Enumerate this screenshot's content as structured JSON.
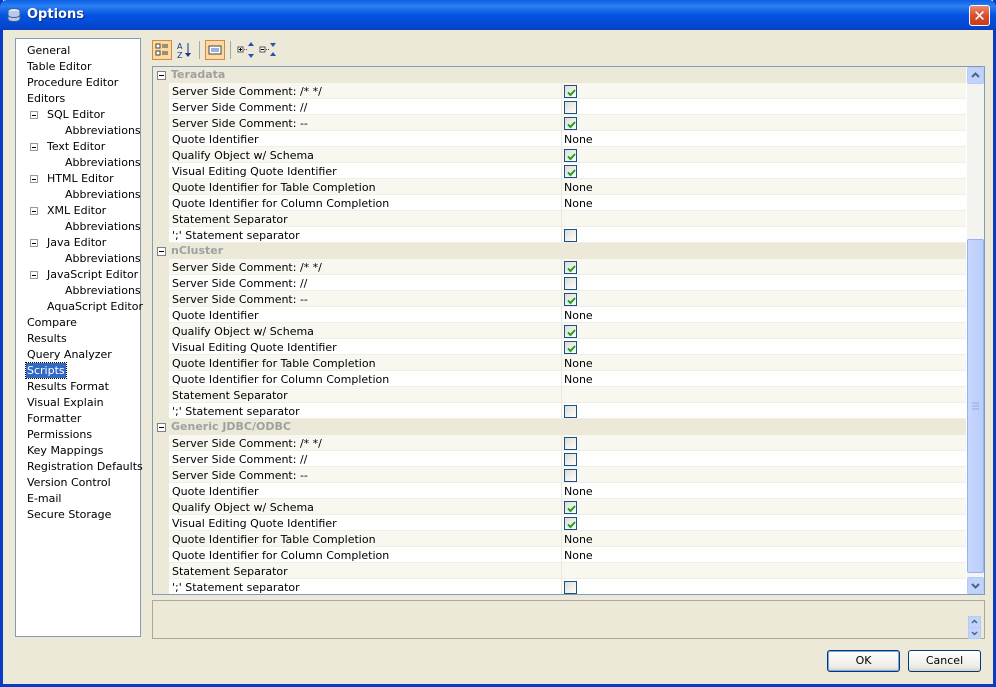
{
  "window": {
    "title": "Options"
  },
  "nav": {
    "selected": "Scripts",
    "items": [
      {
        "label": "General",
        "indent": 0
      },
      {
        "label": "Table Editor",
        "indent": 0
      },
      {
        "label": "Procedure Editor",
        "indent": 0
      },
      {
        "label": "Editors",
        "indent": 0
      },
      {
        "label": "SQL Editor",
        "indent": 1,
        "toggle": true
      },
      {
        "label": "Abbreviations",
        "indent": 2
      },
      {
        "label": "Text Editor",
        "indent": 1,
        "toggle": true
      },
      {
        "label": "Abbreviations",
        "indent": 2
      },
      {
        "label": "HTML Editor",
        "indent": 1,
        "toggle": true
      },
      {
        "label": "Abbreviations",
        "indent": 2
      },
      {
        "label": "XML Editor",
        "indent": 1,
        "toggle": true
      },
      {
        "label": "Abbreviations",
        "indent": 2
      },
      {
        "label": "Java Editor",
        "indent": 1,
        "toggle": true
      },
      {
        "label": "Abbreviations",
        "indent": 2
      },
      {
        "label": "JavaScript Editor",
        "indent": 1,
        "toggle": true
      },
      {
        "label": "Abbreviations",
        "indent": 2
      },
      {
        "label": "AquaScript Editor",
        "indent": 1
      },
      {
        "label": "Compare",
        "indent": 0
      },
      {
        "label": "Results",
        "indent": 0
      },
      {
        "label": "Query Analyzer",
        "indent": 0
      },
      {
        "label": "Scripts",
        "indent": 0
      },
      {
        "label": "Results Format",
        "indent": 0
      },
      {
        "label": "Visual Explain",
        "indent": 0
      },
      {
        "label": "Formatter",
        "indent": 0
      },
      {
        "label": "Permissions",
        "indent": 0
      },
      {
        "label": "Key Mappings",
        "indent": 0
      },
      {
        "label": "Registration Defaults",
        "indent": 0
      },
      {
        "label": "Version Control",
        "indent": 0
      },
      {
        "label": "E-mail",
        "indent": 0
      },
      {
        "label": "Secure Storage",
        "indent": 0
      }
    ]
  },
  "toolbar": {
    "buttons": [
      {
        "name": "categorized-view-icon",
        "active": true
      },
      {
        "name": "sort-alphabetical-icon",
        "active": false
      },
      {
        "name": "property-pages-icon",
        "active": true
      },
      {
        "name": "expand-all-icon",
        "active": false
      },
      {
        "name": "collapse-all-icon",
        "active": false
      }
    ]
  },
  "properties": {
    "categories": [
      {
        "name": "Teradata",
        "rows": [
          {
            "label": "Server Side Comment: /* */",
            "type": "checkbox",
            "checked": true
          },
          {
            "label": "Server Side Comment: //",
            "type": "checkbox",
            "checked": false
          },
          {
            "label": "Server Side Comment: --",
            "type": "checkbox",
            "checked": true
          },
          {
            "label": "Quote Identifier",
            "type": "text",
            "value": "None"
          },
          {
            "label": "Qualify Object w/ Schema",
            "type": "checkbox",
            "checked": true
          },
          {
            "label": "Visual Editing Quote Identifier",
            "type": "checkbox",
            "checked": true
          },
          {
            "label": "Quote Identifier for Table Completion",
            "type": "text",
            "value": "None"
          },
          {
            "label": "Quote Identifier for Column Completion",
            "type": "text",
            "value": "None"
          },
          {
            "label": "Statement Separator",
            "type": "text",
            "value": ""
          },
          {
            "label": "';' Statement separator",
            "type": "checkbox",
            "checked": false
          }
        ]
      },
      {
        "name": "nCluster",
        "rows": [
          {
            "label": "Server Side Comment: /* */",
            "type": "checkbox",
            "checked": true
          },
          {
            "label": "Server Side Comment: //",
            "type": "checkbox",
            "checked": false
          },
          {
            "label": "Server Side Comment: --",
            "type": "checkbox",
            "checked": true
          },
          {
            "label": "Quote Identifier",
            "type": "text",
            "value": "None"
          },
          {
            "label": "Qualify Object w/ Schema",
            "type": "checkbox",
            "checked": true
          },
          {
            "label": "Visual Editing Quote Identifier",
            "type": "checkbox",
            "checked": true
          },
          {
            "label": "Quote Identifier for Table Completion",
            "type": "text",
            "value": "None"
          },
          {
            "label": "Quote Identifier for Column Completion",
            "type": "text",
            "value": "None"
          },
          {
            "label": "Statement Separator",
            "type": "text",
            "value": ""
          },
          {
            "label": "';' Statement separator",
            "type": "checkbox",
            "checked": false
          }
        ]
      },
      {
        "name": "Generic JDBC/ODBC",
        "rows": [
          {
            "label": "Server Side Comment: /* */",
            "type": "checkbox",
            "checked": false
          },
          {
            "label": "Server Side Comment: //",
            "type": "checkbox",
            "checked": false
          },
          {
            "label": "Server Side Comment: --",
            "type": "checkbox",
            "checked": false
          },
          {
            "label": "Quote Identifier",
            "type": "text",
            "value": "None"
          },
          {
            "label": "Qualify Object w/ Schema",
            "type": "checkbox",
            "checked": true
          },
          {
            "label": "Visual Editing Quote Identifier",
            "type": "checkbox",
            "checked": true
          },
          {
            "label": "Quote Identifier for Table Completion",
            "type": "text",
            "value": "None"
          },
          {
            "label": "Quote Identifier for Column Completion",
            "type": "text",
            "value": "None"
          },
          {
            "label": "Statement Separator",
            "type": "text",
            "value": ""
          },
          {
            "label": "';' Statement separator",
            "type": "checkbox",
            "checked": false
          }
        ]
      }
    ]
  },
  "buttons": {
    "ok_label": "OK",
    "cancel_label": "Cancel"
  },
  "colors": {
    "selection": "#316ac5",
    "title_bar": "#0554e3",
    "check": "#21a121"
  }
}
